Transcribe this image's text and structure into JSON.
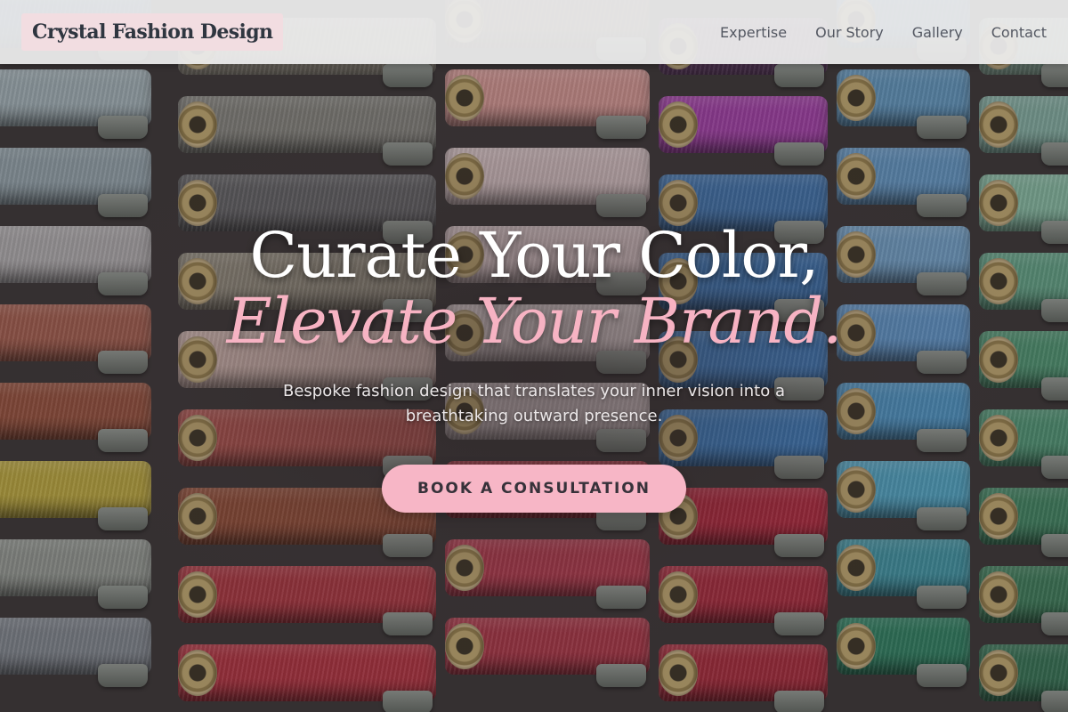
{
  "brand": {
    "name": "Crystal Fashion Design"
  },
  "nav": {
    "items": [
      {
        "label": "Expertise"
      },
      {
        "label": "Our Story"
      },
      {
        "label": "Gallery"
      },
      {
        "label": "Contact"
      }
    ]
  },
  "hero": {
    "headline": "Curate Your Color,",
    "headline_accent": "Elevate Your Brand.",
    "subtitle": "Bespoke fashion design that translates your inner vision into a breathtaking outward presence.",
    "cta_label": "BOOK A CONSULTATION"
  },
  "colors": {
    "accent_pink": "#f7b6c6",
    "header_bg": "#ececec",
    "brand_text": "#2f3640"
  }
}
